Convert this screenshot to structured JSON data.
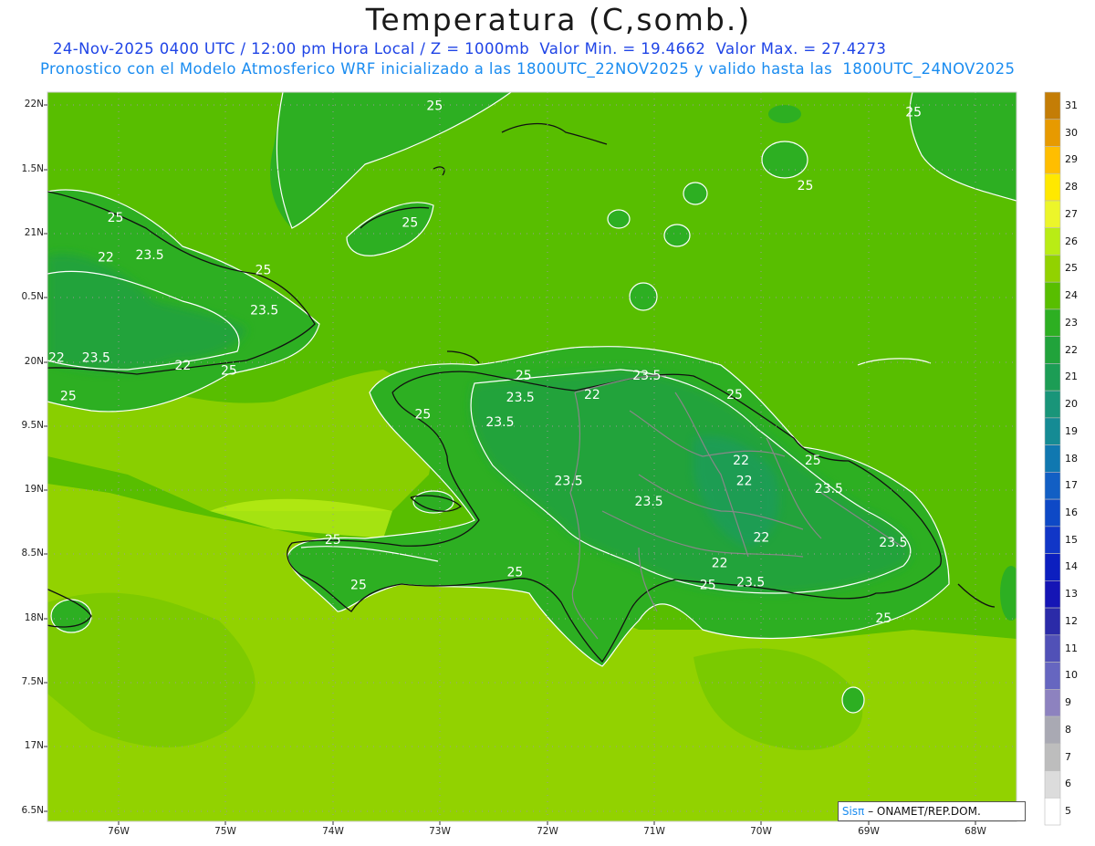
{
  "title": "Temperatura (C,somb.)",
  "subtitle_line1": "24-Nov-2025 0400 UTC / 12:00 pm Hora Local / Z = 1000mb  Valor Min. = 19.4662  Valor Max. = 27.4273",
  "subtitle_line2": "Pronostico con el Modelo Atmosferico WRF inicializado a las 1800UTC_22NOV2025 y valido hasta las  1800UTC_24NOV2025",
  "credit": {
    "prefix": "Sis",
    "pi": "π",
    "rest": " – ONAMET/REP.DOM."
  },
  "lat_labels": [
    "22N",
    "1.5N",
    "21N",
    "0.5N",
    "20N",
    "9.5N",
    "19N",
    "8.5N",
    "18N",
    "7.5N",
    "17N",
    "6.5N"
  ],
  "lon_labels": [
    "76W",
    "75W",
    "74W",
    "73W",
    "72W",
    "71W",
    "70W",
    "69W",
    "68W"
  ],
  "colorbar": {
    "levels": [
      "31",
      "30",
      "29",
      "28",
      "27",
      "26",
      "25",
      "24",
      "23",
      "22",
      "21",
      "20",
      "19",
      "18",
      "17",
      "16",
      "15",
      "14",
      "13",
      "12",
      "11",
      "10",
      "9",
      "8",
      "7",
      "6",
      "5"
    ],
    "colors": [
      "#c47d06",
      "#e79a00",
      "#ffbe00",
      "#ffe800",
      "#ecf52a",
      "#b9ec15",
      "#92d200",
      "#58be00",
      "#2daf22",
      "#21a33b",
      "#1c9d55",
      "#199579",
      "#158b94",
      "#1078b0",
      "#125fc4",
      "#0e49c6",
      "#1136c7",
      "#0c1fbf",
      "#1515b5",
      "#2b2ba8",
      "#5151b7",
      "#6666c0",
      "#8d82bf",
      "#a9a9b3",
      "#bdbdbd",
      "#dcdcdc",
      "#ffffff"
    ]
  },
  "contour_labels": [
    {
      "text": "25",
      "lon": -73.05,
      "lat": 21.96
    },
    {
      "text": "25",
      "lon": -68.58,
      "lat": 21.91
    },
    {
      "text": "25",
      "lon": -69.59,
      "lat": 21.34
    },
    {
      "text": "25",
      "lon": -76.03,
      "lat": 21.09
    },
    {
      "text": "25",
      "lon": -73.28,
      "lat": 21.05
    },
    {
      "text": "22",
      "lon": -76.12,
      "lat": 20.78
    },
    {
      "text": "23.5",
      "lon": -75.71,
      "lat": 20.8
    },
    {
      "text": "25",
      "lon": -74.65,
      "lat": 20.68
    },
    {
      "text": "23.5",
      "lon": -74.64,
      "lat": 20.37
    },
    {
      "text": "22",
      "lon": -76.58,
      "lat": 20.0
    },
    {
      "text": "23.5",
      "lon": -76.21,
      "lat": 20.0
    },
    {
      "text": "22",
      "lon": -75.4,
      "lat": 19.94
    },
    {
      "text": "25",
      "lon": -74.97,
      "lat": 19.9
    },
    {
      "text": "25",
      "lon": -76.47,
      "lat": 19.7
    },
    {
      "text": "25",
      "lon": -72.22,
      "lat": 19.86
    },
    {
      "text": "23.5",
      "lon": -71.07,
      "lat": 19.86
    },
    {
      "text": "25",
      "lon": -70.25,
      "lat": 19.71
    },
    {
      "text": "22",
      "lon": -71.58,
      "lat": 19.71
    },
    {
      "text": "23.5",
      "lon": -72.25,
      "lat": 19.69
    },
    {
      "text": "25",
      "lon": -73.16,
      "lat": 19.56
    },
    {
      "text": "23.5",
      "lon": -72.44,
      "lat": 19.5
    },
    {
      "text": "22",
      "lon": -70.19,
      "lat": 19.2
    },
    {
      "text": "25",
      "lon": -69.52,
      "lat": 19.2
    },
    {
      "text": "23.5",
      "lon": -71.8,
      "lat": 19.04
    },
    {
      "text": "22",
      "lon": -70.16,
      "lat": 19.04
    },
    {
      "text": "23.5",
      "lon": -69.37,
      "lat": 18.98
    },
    {
      "text": "23.5",
      "lon": -71.05,
      "lat": 18.88
    },
    {
      "text": "25",
      "lon": -74.0,
      "lat": 18.58
    },
    {
      "text": "22",
      "lon": -70.0,
      "lat": 18.6
    },
    {
      "text": "23.5",
      "lon": -68.77,
      "lat": 18.56
    },
    {
      "text": "22",
      "lon": -70.39,
      "lat": 18.4
    },
    {
      "text": "25",
      "lon": -72.3,
      "lat": 18.33
    },
    {
      "text": "25",
      "lon": -73.76,
      "lat": 18.23
    },
    {
      "text": "25",
      "lon": -70.5,
      "lat": 18.23
    },
    {
      "text": "23.5",
      "lon": -70.1,
      "lat": 18.25
    },
    {
      "text": "25",
      "lon": -68.86,
      "lat": 17.97
    }
  ]
}
